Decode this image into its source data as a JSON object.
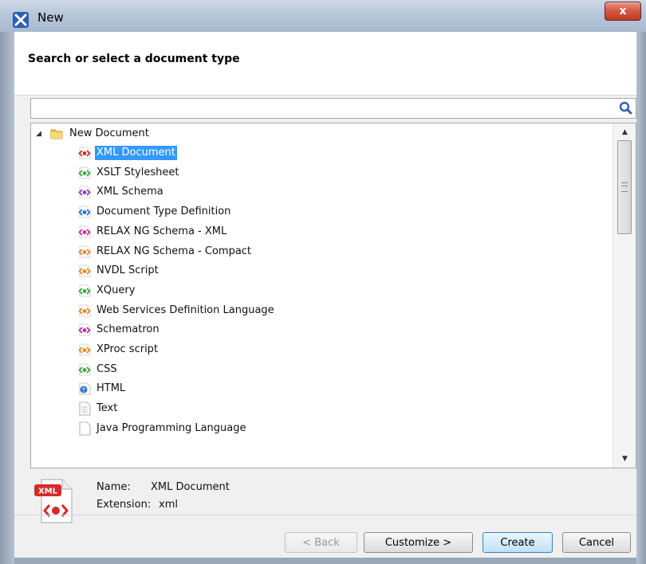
{
  "window": {
    "title": "New",
    "close_label": "x"
  },
  "header": {
    "title": "Search or select a document type"
  },
  "search": {
    "value": "",
    "placeholder": ""
  },
  "tree": {
    "root_label": "New Document",
    "items": [
      {
        "label": "XML Document",
        "icon": "xml-icon",
        "selected": true
      },
      {
        "label": "XSLT Stylesheet",
        "icon": "xslt-icon"
      },
      {
        "label": "XML Schema",
        "icon": "xml-schema-icon"
      },
      {
        "label": "Document Type Definition",
        "icon": "dtd-icon"
      },
      {
        "label": "RELAX NG Schema - XML",
        "icon": "relaxng-xml-icon"
      },
      {
        "label": "RELAX NG Schema - Compact",
        "icon": "relaxng-compact-icon"
      },
      {
        "label": "NVDL Script",
        "icon": "nvdl-icon"
      },
      {
        "label": "XQuery",
        "icon": "xquery-icon"
      },
      {
        "label": "Web Services Definition Language",
        "icon": "wsdl-icon"
      },
      {
        "label": "Schematron",
        "icon": "schematron-icon"
      },
      {
        "label": "XProc script",
        "icon": "xproc-icon"
      },
      {
        "label": "CSS",
        "icon": "css-icon"
      },
      {
        "label": "HTML",
        "icon": "html-icon"
      },
      {
        "label": "Text",
        "icon": "text-file-icon"
      },
      {
        "label": "Java Programming Language",
        "icon": "java-file-icon"
      }
    ]
  },
  "details": {
    "icon_badge": "XML",
    "name_label": "Name:",
    "name_value": "XML Document",
    "extension_label": "Extension:",
    "extension_value": "xml"
  },
  "buttons": {
    "back": "< Back",
    "customize": "Customize >",
    "create": "Create",
    "cancel": "Cancel"
  },
  "colors": {
    "selection": "#3399ff",
    "close": "#c94a33",
    "red_icon": "#d42a2a",
    "green_icon": "#3fa53f",
    "purple_icon": "#8a3fb5",
    "blue_icon": "#2a6fc4",
    "orange_icon": "#e08a1e",
    "pink_icon": "#c0309a"
  }
}
